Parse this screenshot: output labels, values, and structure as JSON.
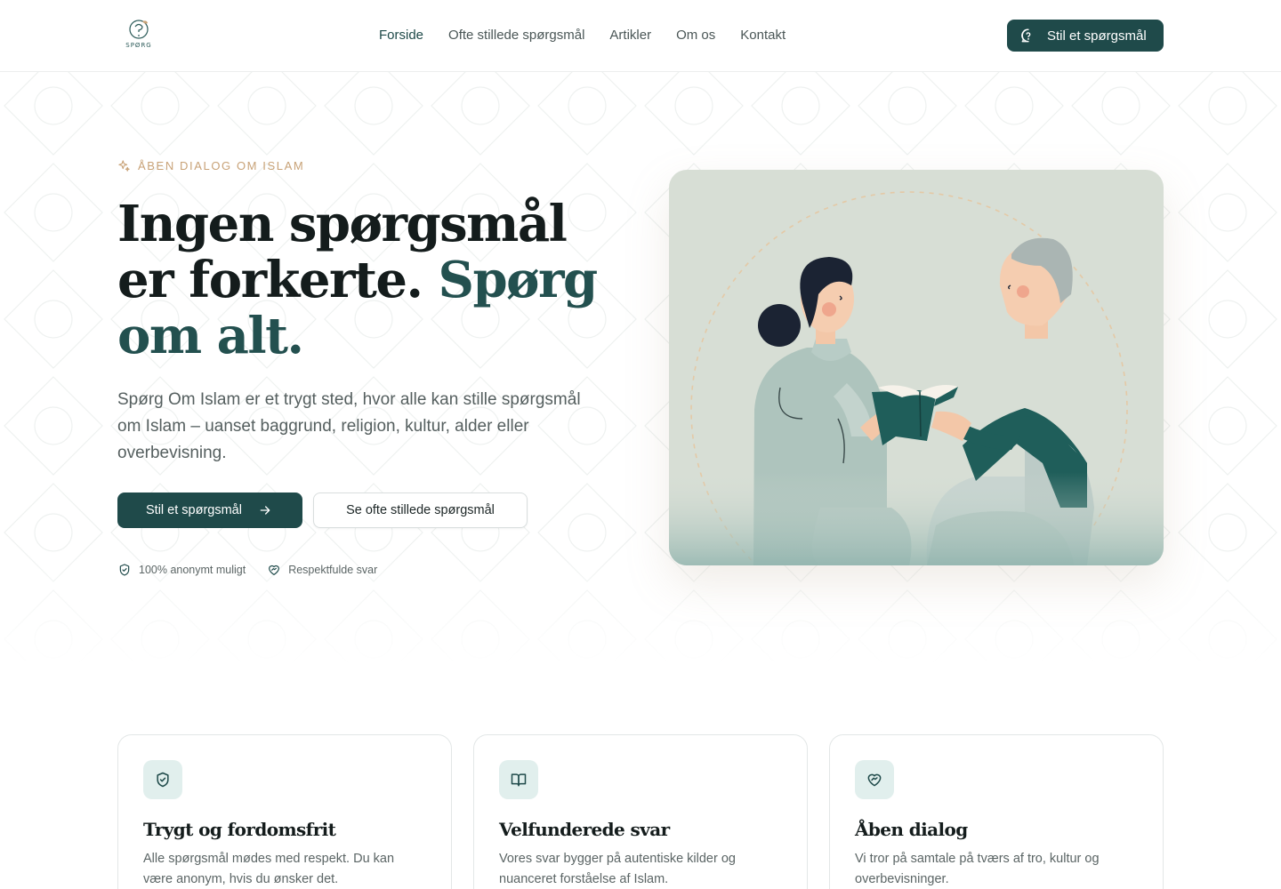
{
  "header": {
    "logo_text": "SPØRG",
    "nav": [
      {
        "label": "Forside",
        "active": true
      },
      {
        "label": "Ofte stillede spørgsmål",
        "active": false
      },
      {
        "label": "Artikler",
        "active": false
      },
      {
        "label": "Om os",
        "active": false
      },
      {
        "label": "Kontakt",
        "active": false
      }
    ],
    "cta_label": "Stil et spørgsmål",
    "cta_icon": "question-bubble-icon"
  },
  "hero": {
    "eyebrow": "ÅBEN DIALOG OM ISLAM",
    "eyebrow_icon": "sparkles-icon",
    "headline_part1": "Ingen spørgsmål er forkerte.",
    "headline_accent": "Spørg om alt.",
    "lead": "Spørg Om Islam er et trygt sted, hvor alle kan stille spørgsmål om Islam – uanset baggrund, religion, kultur, alder eller overbevisning.",
    "primary_button": "Stil et spørgsmål",
    "primary_button_icon": "arrow-right-icon",
    "secondary_button": "Se ofte stillede spørgsmål",
    "trust": [
      {
        "icon": "shield-check-icon",
        "label": "100% anonymt muligt"
      },
      {
        "icon": "heart-handshake-icon",
        "label": "Respektfulde svar"
      }
    ],
    "illustration": "two-people-sharing-book-illustration"
  },
  "cards": [
    {
      "icon": "shield-check-icon",
      "title": "Trygt og fordomsfrit",
      "text": "Alle spørgsmål mødes med respekt. Du kan være anonym, hvis du ønsker det."
    },
    {
      "icon": "open-book-icon",
      "title": "Velfunderede svar",
      "text": "Vores svar bygger på autentiske kilder og nuanceret forståelse af Islam."
    },
    {
      "icon": "heart-handshake-icon",
      "title": "Åben dialog",
      "text": "Vi tror på samtale på tværs af tro, kultur og overbevisninger."
    }
  ],
  "colors": {
    "brand": "#1f4a4a",
    "accent_gold": "#c8a277",
    "card_icon_bg": "#e1efed",
    "illustration_bg": "#d7ded5"
  }
}
